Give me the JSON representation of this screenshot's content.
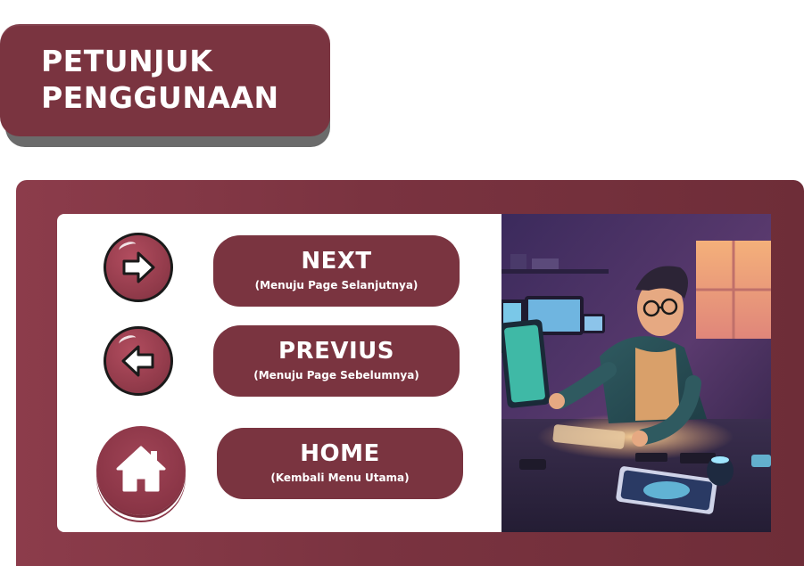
{
  "title": {
    "line1": "PETUNJUK",
    "line2": "PENGGUNAAN"
  },
  "items": [
    {
      "label": "NEXT",
      "desc": "(Menuju Page Selanjutnya)",
      "icon": "arrow-right-icon"
    },
    {
      "label": "PREVIUS",
      "desc": "(Menuju Page Sebelumnya)",
      "icon": "arrow-left-icon"
    },
    {
      "label": "HOME",
      "desc": "(Kembali Menu Utama)",
      "icon": "home-icon"
    }
  ],
  "colors": {
    "brand": "#7a3440",
    "frame": "#8c3c4b",
    "panel": "#ffffff"
  }
}
